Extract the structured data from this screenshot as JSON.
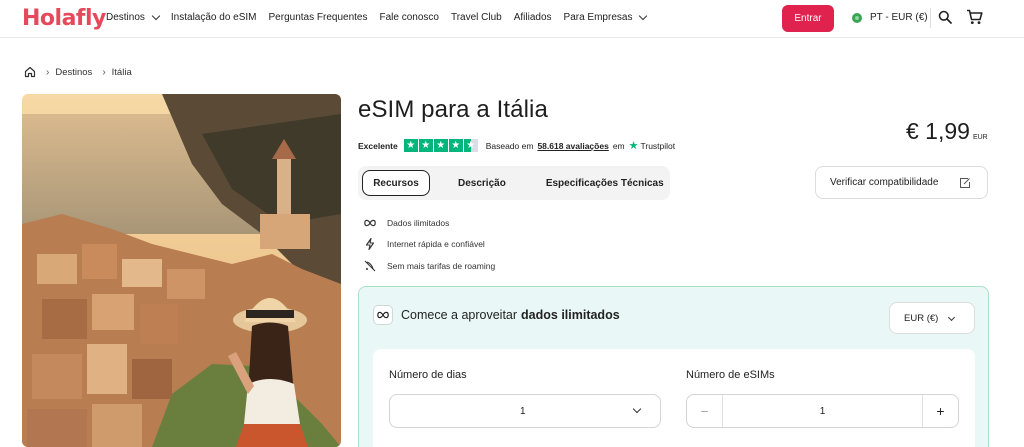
{
  "header": {
    "logo": "Holafly",
    "nav": [
      {
        "label": "Destinos",
        "has_dropdown": true
      },
      {
        "label": "Instalação do eSIM",
        "has_dropdown": false
      },
      {
        "label": "Perguntas Frequentes",
        "has_dropdown": false
      },
      {
        "label": "Fale conosco",
        "has_dropdown": false
      },
      {
        "label": "Travel Club",
        "has_dropdown": false
      },
      {
        "label": "Afiliados",
        "has_dropdown": false
      },
      {
        "label": "Para Empresas",
        "has_dropdown": true
      }
    ],
    "login_label": "Entrar",
    "locale_label": "PT - EUR (€)",
    "icons": [
      "search-icon",
      "cart-icon"
    ],
    "accent_color": "#e0234e"
  },
  "breadcrumb": {
    "items": [
      "Destinos",
      "Itália"
    ]
  },
  "product": {
    "title": "eSIM para a Itália",
    "rating_label": "Excelente",
    "rating_stars": 4.5,
    "based_on": "Baseado em",
    "reviews_count": "58.618 avaliações",
    "in_label": "em",
    "trustpilot": "Trustpilot",
    "price": "€ 1,99",
    "price_currency": "EUR",
    "tabs": [
      "Recursos",
      "Descrição",
      "Especificações Técnicas"
    ],
    "active_tab": "Recursos",
    "compat_label": "Verificar compatibilidade",
    "features": [
      {
        "icon": "infinity-icon",
        "label": "Dados ilimitados"
      },
      {
        "icon": "lightning-icon",
        "label": "Internet rápida e confiável"
      },
      {
        "icon": "no-roaming-icon",
        "label": "Sem mais tarifas de roaming"
      }
    ]
  },
  "plan": {
    "heading_prefix": "Comece a aproveitar",
    "heading_bold": "dados ilimitados",
    "currency_select": "EUR (€)",
    "days_label": "Número de dias",
    "days_value": "1",
    "esims_label": "Número de eSIMs",
    "esims_value": "1",
    "minus": "−",
    "plus": "+"
  }
}
